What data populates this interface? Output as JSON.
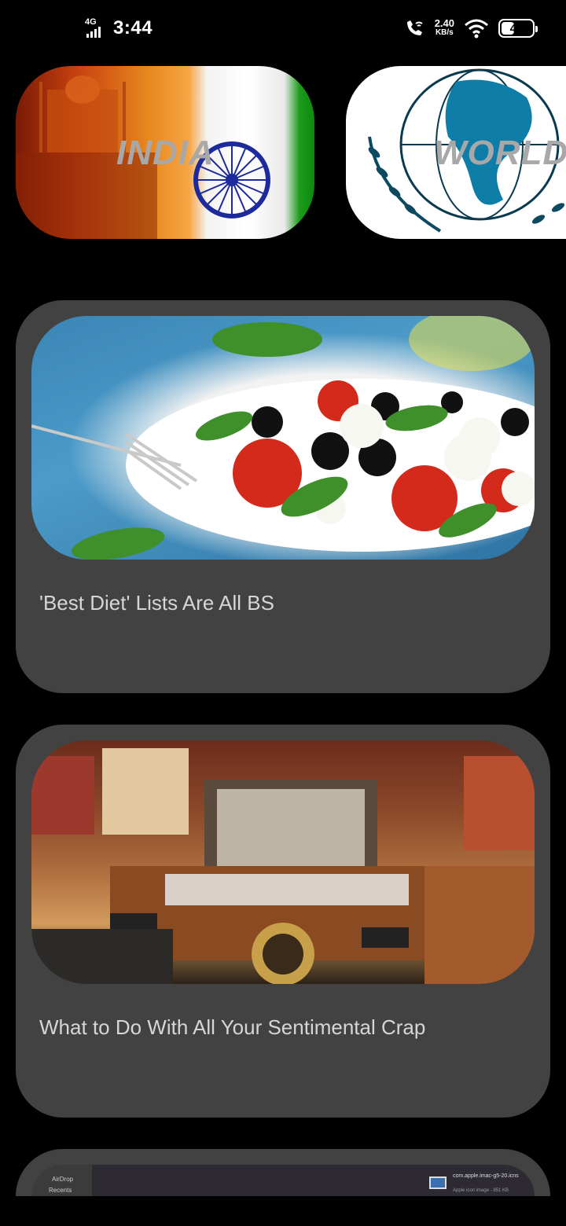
{
  "status_bar": {
    "network_label": "4G",
    "time": "3:44",
    "speed_value": "2.40",
    "speed_unit": "KB/s",
    "battery": "43",
    "battery_level": 0.43
  },
  "categories": [
    {
      "label": "INDIA"
    },
    {
      "label": "WORLD"
    }
  ],
  "articles": [
    {
      "title": "'Best Diet' Lists Are All BS"
    },
    {
      "title": "What to Do With All Your Sentimental Crap"
    }
  ],
  "partial_card": {
    "sidebar_items": [
      "AirDrop",
      "Recents"
    ],
    "file_name": "com.apple.imac-g5-20.icns",
    "file_meta": "Apple icon image - 851 KB"
  },
  "colors": {
    "background": "#000000",
    "card": "#424242",
    "title_text": "#d6d6d6",
    "chip_label": "#a8a8a8"
  }
}
